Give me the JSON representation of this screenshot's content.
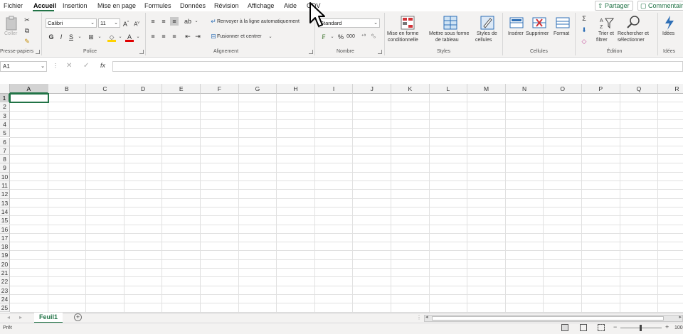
{
  "tabs": [
    {
      "label": "Fichier",
      "active": false
    },
    {
      "label": "Accueil",
      "active": true
    },
    {
      "label": "Insertion",
      "active": false
    },
    {
      "label": "Mise en page",
      "active": false
    },
    {
      "label": "Formules",
      "active": false
    },
    {
      "label": "Données",
      "active": false
    },
    {
      "label": "Révision",
      "active": false
    },
    {
      "label": "Affichage",
      "active": false
    },
    {
      "label": "Aide",
      "active": false
    },
    {
      "label": "ODV",
      "active": false
    }
  ],
  "header": {
    "share_label": "Partager",
    "comments_label": "Commentaires"
  },
  "ribbon": {
    "clipboard": {
      "group_label": "Presse-papiers",
      "paste_label": "Coller"
    },
    "font": {
      "group_label": "Police",
      "font_name": "Calibri",
      "font_size": "11",
      "bold": "G",
      "italic": "I",
      "underline": "S"
    },
    "alignment": {
      "group_label": "Alignement",
      "wrap_label": "Renvoyer à la ligne automatiquement",
      "merge_label": "Fusionner et centrer"
    },
    "number": {
      "group_label": "Nombre",
      "format": "Standard"
    },
    "styles": {
      "group_label": "Styles",
      "conditional_l1": "Mise en forme",
      "conditional_l2": "conditionnelle",
      "table_l1": "Mettre sous forme",
      "table_l2": "de tableau",
      "cell_styles_l1": "Styles de",
      "cell_styles_l2": "cellules"
    },
    "cells": {
      "group_label": "Cellules",
      "insert": "Insérer",
      "delete": "Supprimer",
      "format": "Format"
    },
    "editing": {
      "group_label": "Édition",
      "sort_l1": "Trier et",
      "sort_l2": "filtrer",
      "find_l1": "Rechercher et",
      "find_l2": "sélectionner"
    },
    "ideas": {
      "group_label": "Idées",
      "ideas_label": "Idées"
    }
  },
  "formula_bar": {
    "name_box": "A1",
    "fx_label": "fx",
    "formula": ""
  },
  "grid": {
    "columns": [
      "A",
      "B",
      "C",
      "D",
      "E",
      "F",
      "G",
      "H",
      "I",
      "J",
      "K",
      "L",
      "M",
      "N",
      "O",
      "P",
      "Q",
      "R"
    ],
    "rows": [
      "1",
      "2",
      "3",
      "4",
      "5",
      "6",
      "7",
      "8",
      "9",
      "10",
      "11",
      "12",
      "13",
      "14",
      "15",
      "16",
      "17",
      "18",
      "19",
      "20",
      "21",
      "22",
      "23",
      "24",
      "25"
    ],
    "active_cell": "A1"
  },
  "sheets": {
    "tabs": [
      "Feuil1"
    ],
    "add_label": "+"
  },
  "status": {
    "ready": "Prêt",
    "zoom": "100"
  },
  "colors": {
    "accent": "#217346",
    "ribbon_bg": "#f3f2f1"
  }
}
